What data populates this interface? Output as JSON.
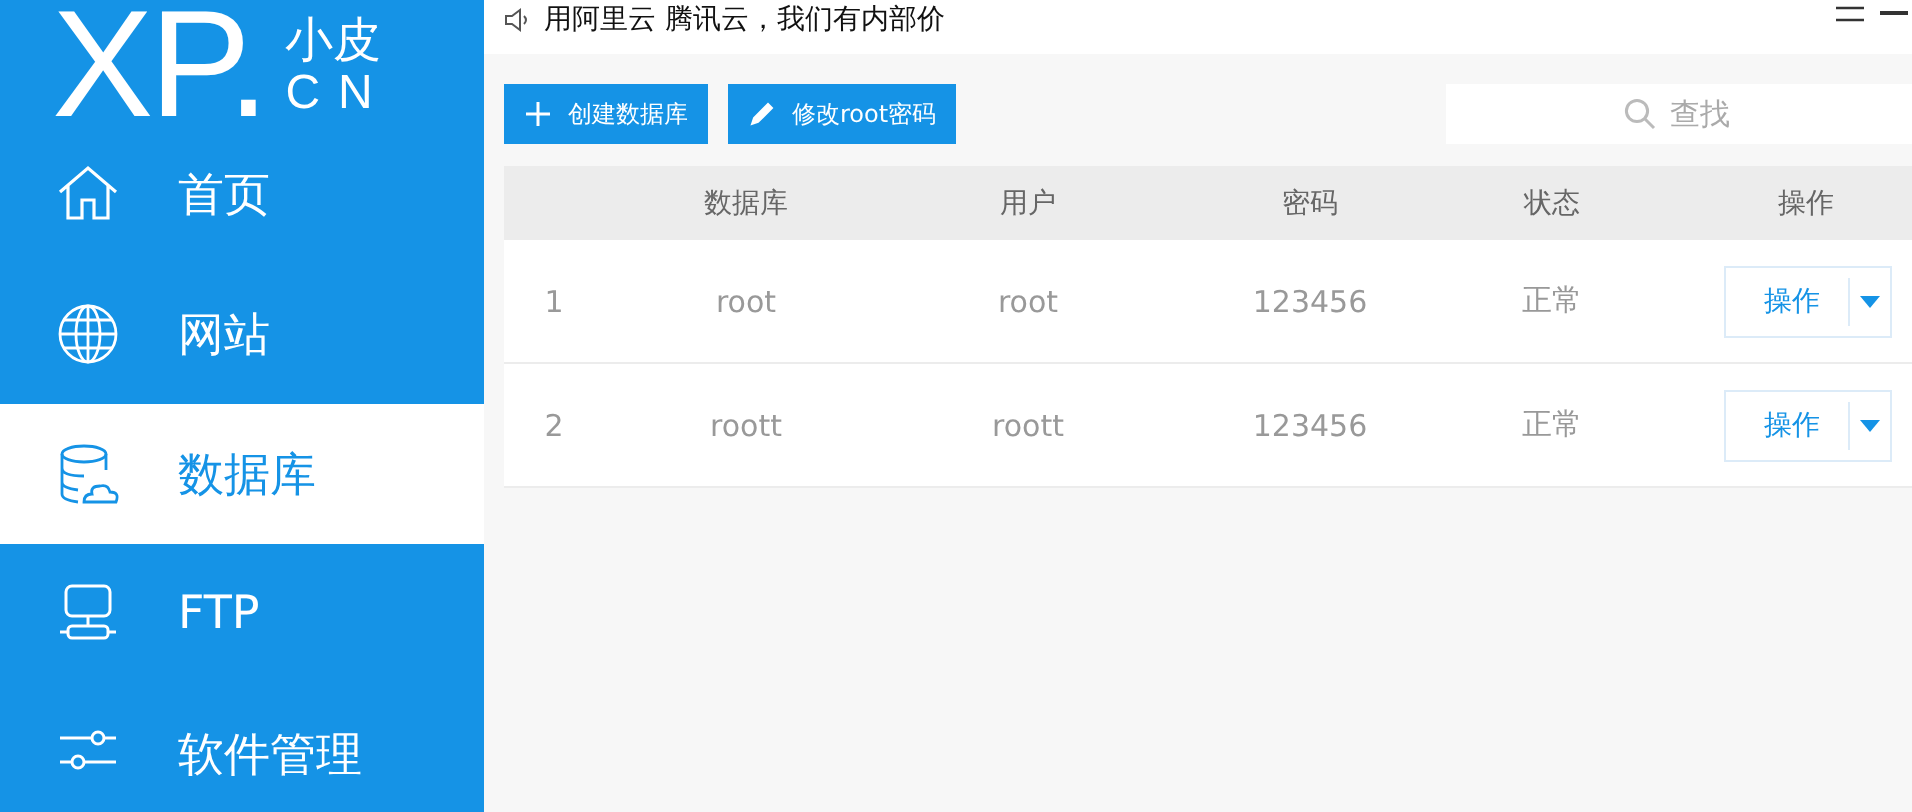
{
  "logo": {
    "mark": "XP.",
    "name": "小皮",
    "domain": "CN"
  },
  "sidebar": {
    "items": [
      {
        "label": "首页",
        "kind": "home",
        "selected": false
      },
      {
        "label": "网站",
        "kind": "globe",
        "selected": false
      },
      {
        "label": "数据库",
        "kind": "database",
        "selected": true
      },
      {
        "label": "FTP",
        "kind": "server",
        "selected": false
      },
      {
        "label": "软件管理",
        "kind": "sliders",
        "selected": false
      }
    ]
  },
  "banner": {
    "text": "用阿里云 腾讯云，我们有内部价"
  },
  "toolbar": {
    "buttons": [
      {
        "label": "创建数据库",
        "kind": "add"
      },
      {
        "label": "修改root密码",
        "kind": "edit"
      }
    ]
  },
  "search": {
    "placeholder": "查找"
  },
  "table": {
    "columns": [
      "数据库",
      "用户",
      "密码",
      "状态",
      "操作"
    ],
    "rows": [
      {
        "index": "1",
        "database": "root",
        "user": "root",
        "password": "123456",
        "status": "正常",
        "action": "操作"
      },
      {
        "index": "2",
        "database": "roott",
        "user": "roott",
        "password": "123456",
        "status": "正常",
        "action": "操作"
      }
    ]
  }
}
